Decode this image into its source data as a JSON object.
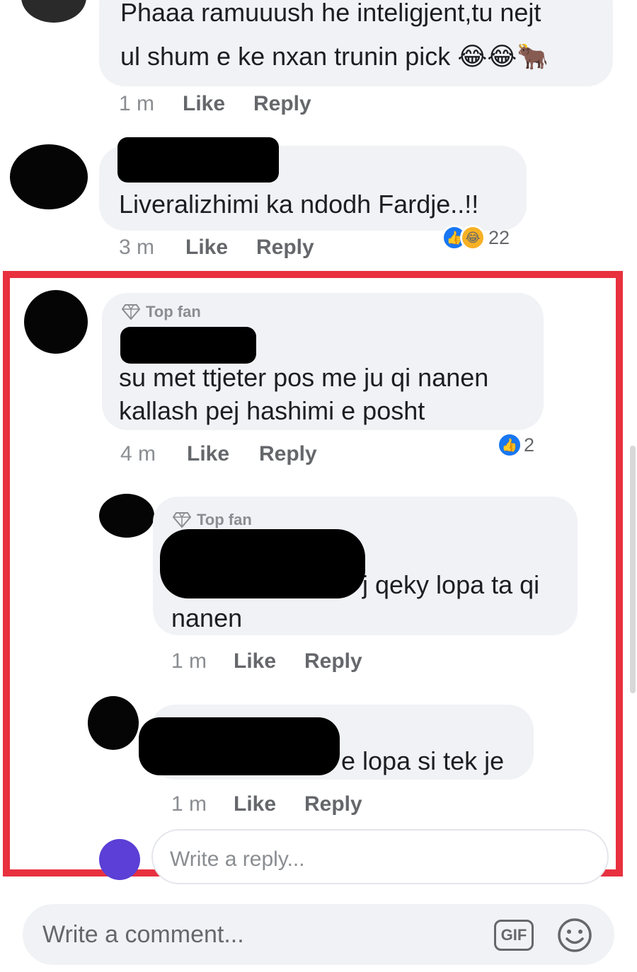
{
  "comments": [
    {
      "text_lines": [
        "Phaaa ramuuush  he inteligjent,tu nejt",
        "ul shum e ke nxan trunin pick 😂😂🐂"
      ],
      "time": "1 m",
      "like_label": "Like",
      "reply_label": "Reply"
    },
    {
      "text_lines": [
        "Liveralizhimi ka ndodh Fardje..!!"
      ],
      "time": "3 m",
      "like_label": "Like",
      "reply_label": "Reply",
      "reaction_count": "22",
      "reaction_icons": [
        "like-icon",
        "haha-icon"
      ]
    },
    {
      "badge": "Top fan",
      "text_lines": [
        "su met ttjeter pos me ju qi nanen",
        "kallash pej hashimi e posht"
      ],
      "time": "4 m",
      "like_label": "Like",
      "reply_label": "Reply",
      "reaction_count": "2",
      "reaction_icons": [
        "like-icon"
      ]
    }
  ],
  "replies": [
    {
      "badge": "Top fan",
      "text_lines": [
        "j qeky lopa ta qi",
        "nanen"
      ],
      "time": "1 m",
      "like_label": "Like",
      "reply_label": "Reply"
    },
    {
      "text_lines": [
        "e lopa si tek je"
      ],
      "time": "1 m",
      "like_label": "Like",
      "reply_label": "Reply"
    }
  ],
  "reply_input": {
    "placeholder": "Write a reply..."
  },
  "comment_input": {
    "placeholder": "Write a comment...",
    "gif_label": "GIF"
  },
  "colors": {
    "highlight_border": "#e8303f",
    "like_blue": "#1877f2",
    "bubble_bg": "#f0f2f5",
    "reply_avatar": "#5b3fd6"
  },
  "icons": [
    "diamond-icon",
    "like-icon",
    "haha-icon",
    "gif-icon",
    "smiley-icon"
  ]
}
